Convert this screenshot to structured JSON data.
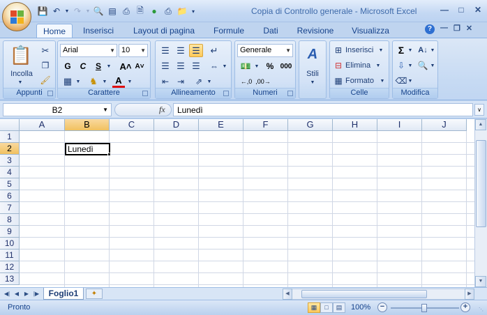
{
  "window": {
    "title": "Copia di Controllo generale - Microsoft Excel"
  },
  "ribbon_tabs": [
    {
      "label": "Home",
      "active": true
    },
    {
      "label": "Inserisci"
    },
    {
      "label": "Layout di pagina"
    },
    {
      "label": "Formule"
    },
    {
      "label": "Dati"
    },
    {
      "label": "Revisione"
    },
    {
      "label": "Visualizza"
    }
  ],
  "groups": {
    "appunti": {
      "label": "Appunti",
      "paste": "Incolla"
    },
    "carattere": {
      "label": "Carattere",
      "font": "Arial",
      "size": "10",
      "bold": "G",
      "italic": "C",
      "underline": "S"
    },
    "allineamento": {
      "label": "Allineamento"
    },
    "numeri": {
      "label": "Numeri",
      "format": "Generale",
      "percent": "%",
      "thousands": "000"
    },
    "stili": {
      "label": "Stili"
    },
    "celle": {
      "label": "Celle",
      "insert": "Inserisci",
      "delete": "Elimina",
      "format": "Formato"
    },
    "modifica": {
      "label": "Modifica"
    }
  },
  "formula_bar": {
    "name_box": "B2",
    "fx": "fx",
    "content": "Lunedì"
  },
  "columns": [
    "A",
    "B",
    "C",
    "D",
    "E",
    "F",
    "G",
    "H",
    "I",
    "J"
  ],
  "rows": [
    "1",
    "2",
    "3",
    "4",
    "5",
    "6",
    "7",
    "8",
    "9",
    "10",
    "11",
    "12",
    "13"
  ],
  "active_cell": {
    "ref": "B2",
    "value": "Lunedì"
  },
  "sheets": [
    "Foglio1"
  ],
  "status": {
    "text": "Pronto",
    "zoom": "100%",
    "zoom_fraction": 0.5
  }
}
